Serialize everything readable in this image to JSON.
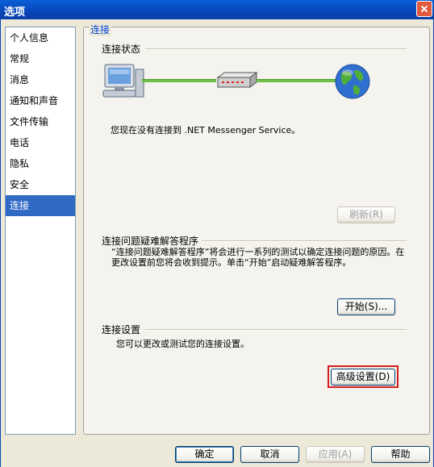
{
  "window": {
    "title": "选项"
  },
  "sidebar": {
    "items": [
      {
        "label": "个人信息"
      },
      {
        "label": "常规"
      },
      {
        "label": "消息"
      },
      {
        "label": "通知和声音"
      },
      {
        "label": "文件传输"
      },
      {
        "label": "电话"
      },
      {
        "label": "隐私"
      },
      {
        "label": "安全"
      },
      {
        "label": "连接"
      }
    ],
    "selected": "连接"
  },
  "panel": {
    "title": "连接",
    "status_group": {
      "label": "连接状态",
      "message": "您现在没有连接到 .NET Messenger Service。",
      "refresh_label": "刷新(R)"
    },
    "troubleshoot_group": {
      "label": "连接问题疑难解答程序",
      "description": "“连接问题疑难解答程序”将会进行一系列的测试以确定连接问题的原因。在更改设置前您将会收到提示。单击“开始”启动疑难解答程序。",
      "start_label": "开始(S)..."
    },
    "settings_group": {
      "label": "连接设置",
      "description": "您可以更改或测试您的连接设置。",
      "advanced_label": "高级设置(D)"
    }
  },
  "footer": {
    "ok_label": "确定",
    "cancel_label": "取消",
    "apply_label": "应用(A)",
    "help_label": "帮助"
  },
  "colors": {
    "accent": "#316ac5",
    "highlight_box": "#d61c1c",
    "cable": "#6fbf4a"
  }
}
